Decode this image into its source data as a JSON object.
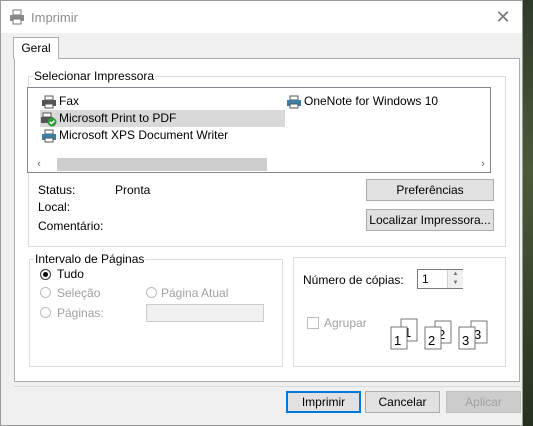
{
  "window": {
    "title": "Imprimir",
    "close_glyph": "✕"
  },
  "tabs": [
    {
      "label": "Geral"
    }
  ],
  "printer_group": {
    "legend": "Selecionar Impressora"
  },
  "printers": [
    {
      "name": "Fax",
      "icon": "printer-icon"
    },
    {
      "name": "Microsoft Print to PDF",
      "icon": "default-printer-icon",
      "selected": true
    },
    {
      "name": "Microsoft XPS Document Writer",
      "icon": "printer-icon"
    },
    {
      "name": "OneNote for Windows 10",
      "icon": "printer-icon"
    }
  ],
  "scroll": {
    "left": "‹",
    "right": "›"
  },
  "info": {
    "status_label": "Status:",
    "status_value": "Pronta",
    "location_label": "Local:",
    "location_value": "",
    "comment_label": "Comentário:",
    "comment_value": ""
  },
  "buttons": {
    "preferences": "Preferências",
    "find_printer": "Localizar Impressora...",
    "print": "Imprimir",
    "cancel": "Cancelar",
    "apply": "Aplicar"
  },
  "page_range": {
    "legend": "Intervalo de Páginas",
    "all": "Tudo",
    "selection": "Seleção",
    "current_page": "Página Atual",
    "pages": "Páginas:",
    "selected": "all"
  },
  "copies": {
    "label": "Número de cópias:",
    "value": "1",
    "collate_label": "Agrupar",
    "collate_checked": false,
    "collate_pages": [
      "1",
      "1",
      "2",
      "2",
      "3",
      "3"
    ]
  },
  "colors": {
    "accent": "#0078d7",
    "selection": "#d9d9d9"
  }
}
